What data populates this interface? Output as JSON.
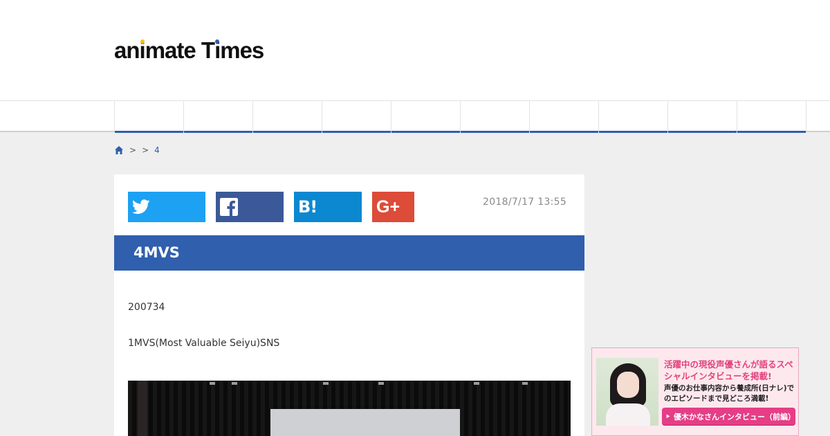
{
  "brand": {
    "logo_parts": [
      "an",
      "i",
      "mate T",
      "i",
      "mes"
    ],
    "logo_colors": {
      "i_first": "#f5c400",
      "i_second": "#2f5fad"
    }
  },
  "nav": {
    "item_count": 10,
    "accent_color": "#2f5fad"
  },
  "breadcrumb": {
    "home_icon": "home-icon",
    "separator_1": ">",
    "separator_2": ">",
    "current": "4"
  },
  "share": {
    "twitter_icon": "twitter-icon",
    "facebook_icon": "facebook-icon",
    "hatena_label": "B!",
    "googleplus_label": "G+",
    "colors": {
      "twitter": "#1da1f2",
      "facebook": "#3b5998",
      "hatena": "#0c88d1",
      "googleplus": "#dd4b39"
    }
  },
  "article": {
    "date": "2018/7/17 13:55",
    "title": "4MVS",
    "paragraphs": [
      "200734",
      "1MVS(Most Valuable Seiyu)SNS"
    ]
  },
  "ad": {
    "headline": "活躍中の現役声優さんが語るスペシャルインタビューを掲載!",
    "subtext": "声優のお仕事内容から養成所(日ナレ)でのエピソードまで見どころ満載!",
    "button_label": "優木かなさんインタビュー（前編）",
    "button_icon": "play-icon"
  }
}
